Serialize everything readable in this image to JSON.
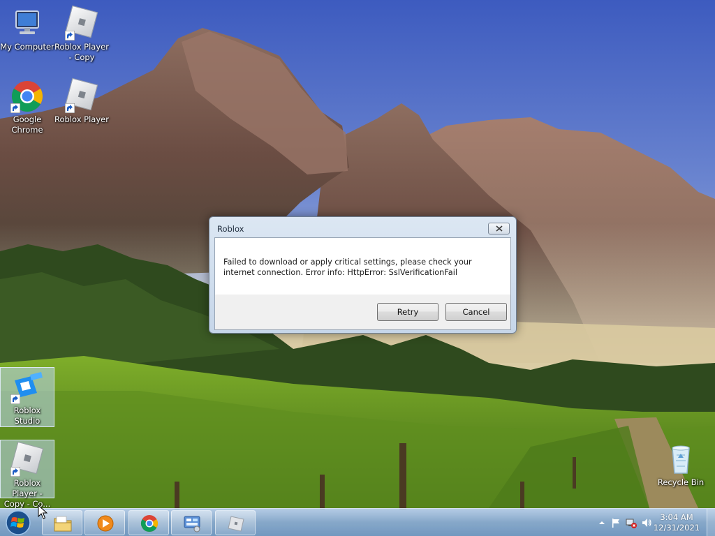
{
  "desktop": {
    "icons": [
      {
        "label": "My Computer",
        "icon": "computer-icon"
      },
      {
        "label": "Roblox Player - Copy",
        "icon": "roblox-player-icon"
      },
      {
        "label": "Google Chrome",
        "icon": "chrome-icon"
      },
      {
        "label": "Roblox Player",
        "icon": "roblox-player-icon"
      },
      {
        "label": "Roblox Studio",
        "icon": "roblox-studio-icon"
      },
      {
        "label": "Roblox Player - Copy - Co...",
        "icon": "roblox-player-icon"
      },
      {
        "label": "Recycle Bin",
        "icon": "recycle-bin-icon"
      }
    ]
  },
  "dialog": {
    "title": "Roblox",
    "message": "Failed to download or apply critical settings, please check your internet connection. Error info: HttpError: SslVerificationFail",
    "retry_label": "Retry",
    "cancel_label": "Cancel"
  },
  "taskbar": {
    "items": [
      {
        "icon": "file-explorer-icon"
      },
      {
        "icon": "media-player-icon"
      },
      {
        "icon": "chrome-icon"
      },
      {
        "icon": "control-panel-icon"
      },
      {
        "icon": "roblox-player-icon"
      }
    ],
    "clock": {
      "time": "3:04 AM",
      "date": "12/31/2021"
    }
  },
  "colors": {
    "taskbar": "#8fb0d2",
    "dialog_frame": "#c9d8ea",
    "sky": "#4a67c2"
  }
}
